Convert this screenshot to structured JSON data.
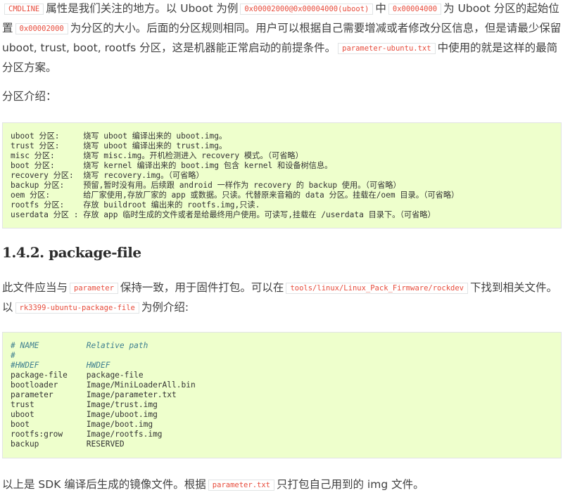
{
  "intro": {
    "code_cmdline": "CMDLINE",
    "t1": "属性是我们关注的地方。以 Uboot 为例",
    "code_uboot": "0x00002000@0x00004000(uboot)",
    "t2": "中",
    "code_offset": "0x00004000",
    "t3": "为 Uboot 分区的起始位置",
    "code_size": "0x00002000",
    "t4": "为分区的大小。后面的分区规则相同。用户可以根据自己需要增减或者修改分区信息，但是请最少保留 uboot, trust, boot, rootfs 分区，这是机器能正常启动的前提条件。",
    "code_param": "parameter-ubuntu.txt",
    "t5": "中使用的就是这样的最简分区方案。"
  },
  "partition_intro_label": "分区介绍：",
  "partition_lines": [
    "uboot 分区:     烧写 uboot 编译出来的 uboot.img。",
    "trust 分区:     烧写 uboot 编译出来的 trust.img。",
    "misc 分区:      烧写 misc.img。开机检测进入 recovery 模式。（可省略）",
    "boot 分区:      烧写 kernel 编译出来的 boot.img 包含 kernel 和设备树信息。",
    "recovery 分区:  烧写 recovery.img。（可省略）",
    "backup 分区:    预留,暂时没有用。后续跟 android 一样作为 recovery 的 backup 使用。（可省略）",
    "oem 分区:       给厂家使用,存放厂家的 app 或数据。只读。代替原来音箱的 data 分区。挂载在/oem 目录。（可省略）",
    "rootfs 分区:    存放 buildroot 编出来的 rootfs.img,只读.",
    "userdata 分区 : 存放 app 临时生成的文件或者是给最终用户使用。可读写,挂载在 /userdata 目录下。（可省略）"
  ],
  "section_heading": "1.4.2. package-file",
  "pkg_intro": {
    "t1": "此文件应当与",
    "code_parameter": "parameter",
    "t2": "保持一致，用于固件打包。可以在",
    "code_path": "tools/linux/Linux_Pack_Firmware/rockdev",
    "t3": "下找到相关文件。以",
    "code_file": "rk3399-ubuntu-package-file",
    "t4": "为例介绍:"
  },
  "package_comments": [
    "# NAME          Relative path",
    "#",
    "#HWDEF          HWDEF"
  ],
  "package_lines": [
    "package-file    package-file",
    "bootloader      Image/MiniLoaderAll.bin",
    "parameter       Image/parameter.txt",
    "trust           Image/trust.img",
    "uboot           Image/uboot.img",
    "boot            Image/boot.img",
    "rootfs:grow     Image/rootfs.img",
    "backup          RESERVED"
  ],
  "outro": {
    "t1": "以上是 SDK 编译后生成的镜像文件。根据",
    "code_param": "parameter.txt",
    "t2": "只打包自己用到的 img 文件。"
  }
}
